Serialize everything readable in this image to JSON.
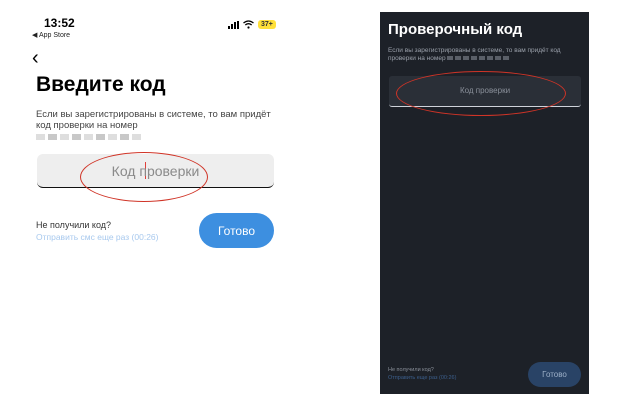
{
  "left_screen": {
    "status_time": "13:52",
    "back_app": "◀ App Store",
    "battery": "37+",
    "back_glyph": "‹",
    "title": "Введите код",
    "description": "Если вы зарегистрированы в системе, то вам придёт код проверки на номер",
    "input_placeholder": "Код проверки",
    "not_received": "Не получили код?",
    "resend": "Отправить смс еще раз (00:26)",
    "done_button": "Готово",
    "colors": {
      "accent": "#3d8fe0",
      "annotation": "#d03427"
    }
  },
  "right_screen": {
    "title": "Проверочный код",
    "description_start": "Если вы зарегистрированы в системе, то вам придёт код проверки на номер",
    "input_placeholder": "Код проверки",
    "not_received": "Не получили код?",
    "resend": "Отправить еще раз (00:26)",
    "done_button": "Готово",
    "colors": {
      "background": "#1d2128",
      "button": "#294366"
    }
  }
}
